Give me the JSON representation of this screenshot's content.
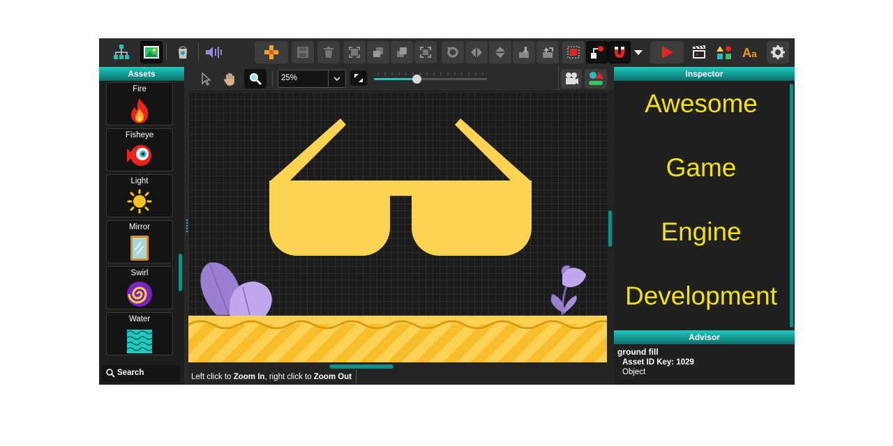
{
  "toolbar": {
    "buttons": [
      "hierarchy",
      "scene-view",
      "record",
      "audio",
      "add",
      "save",
      "delete",
      "expand",
      "arrange-back",
      "arrange-front",
      "fit",
      "rotate",
      "flip-horizontal",
      "flip-vertical",
      "import",
      "export",
      "grid-snap",
      "connect",
      "magnet",
      "more",
      "play",
      "clapboard",
      "shapes",
      "text",
      "settings"
    ]
  },
  "assets": {
    "title": "Assets",
    "items": [
      {
        "label": "Fire",
        "icon": "fire-icon"
      },
      {
        "label": "Fisheye",
        "icon": "fisheye-icon"
      },
      {
        "label": "Light",
        "icon": "sun-icon"
      },
      {
        "label": "Mirror",
        "icon": "mirror-icon"
      },
      {
        "label": "Swirl",
        "icon": "swirl-icon"
      },
      {
        "label": "Water",
        "icon": "water-icon"
      }
    ],
    "search_label": "Search"
  },
  "canvas": {
    "zoom_value": "25%",
    "zoom_slider_fraction": 0.38,
    "status_prefix": "Left click to ",
    "status_zoom_in": "Zoom In",
    "status_mid": ", right click to ",
    "status_zoom_out": "Zoom Out"
  },
  "inspector": {
    "title": "Inspector",
    "lines": [
      "Awesome",
      "Game",
      "Engine",
      "Development"
    ]
  },
  "advisor": {
    "title": "Advisor",
    "name": "ground fill",
    "key_label": "Asset ID Key: 1029",
    "type": "Object"
  },
  "colors": {
    "accent": "#14b3ab",
    "inspector_text": "#f2e20d",
    "glasses": "#fdd451",
    "ground": "#f7bd2a",
    "plant": "#a385d6"
  }
}
